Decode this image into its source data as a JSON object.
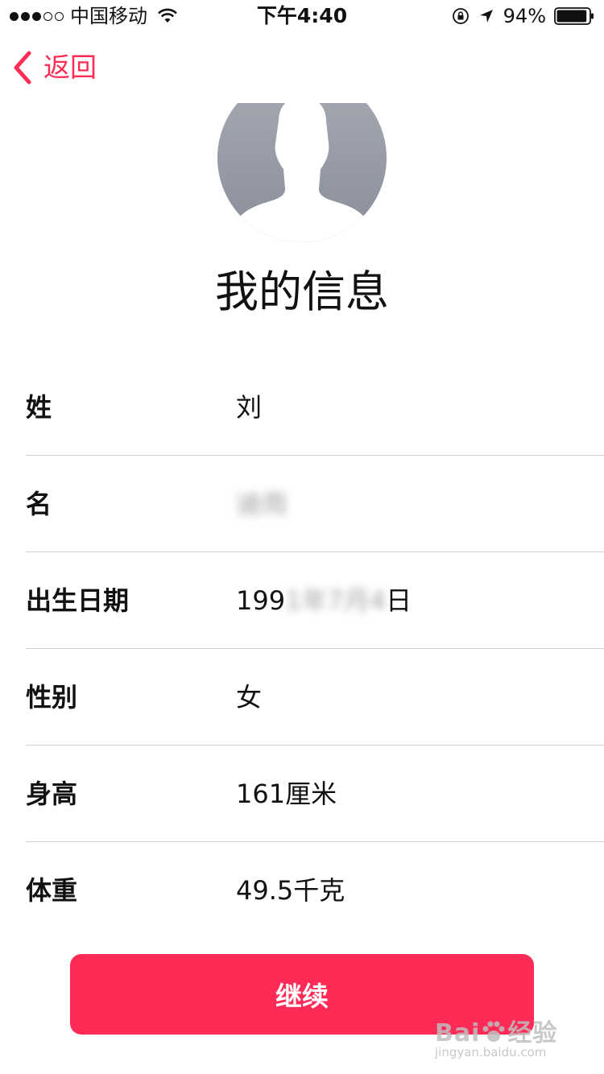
{
  "status_bar": {
    "carrier": "中国移动",
    "time": "下午4:40",
    "battery": "94%",
    "battery_level": 0.94
  },
  "nav": {
    "back_label": "返回"
  },
  "title": "我的信息",
  "rows": [
    {
      "label": "姓",
      "value": "刘"
    },
    {
      "label": "名",
      "value": "迪雨"
    },
    {
      "label": "出生日期",
      "value_visible": "199",
      "value_blurred": "1年7月4",
      "value_tail": "日"
    },
    {
      "label": "性别",
      "value": "女"
    },
    {
      "label": "身高",
      "value": "161厘米"
    },
    {
      "label": "体重",
      "value": "49.5千克"
    }
  ],
  "continue_label": "继续",
  "watermark": {
    "brand": "Bai",
    "brand_cn": "经验",
    "url": "jingyan.baidu.com"
  },
  "colors": {
    "accent": "#ff2d55",
    "button": "#ff2a55",
    "avatar": "#9a9ea8"
  }
}
